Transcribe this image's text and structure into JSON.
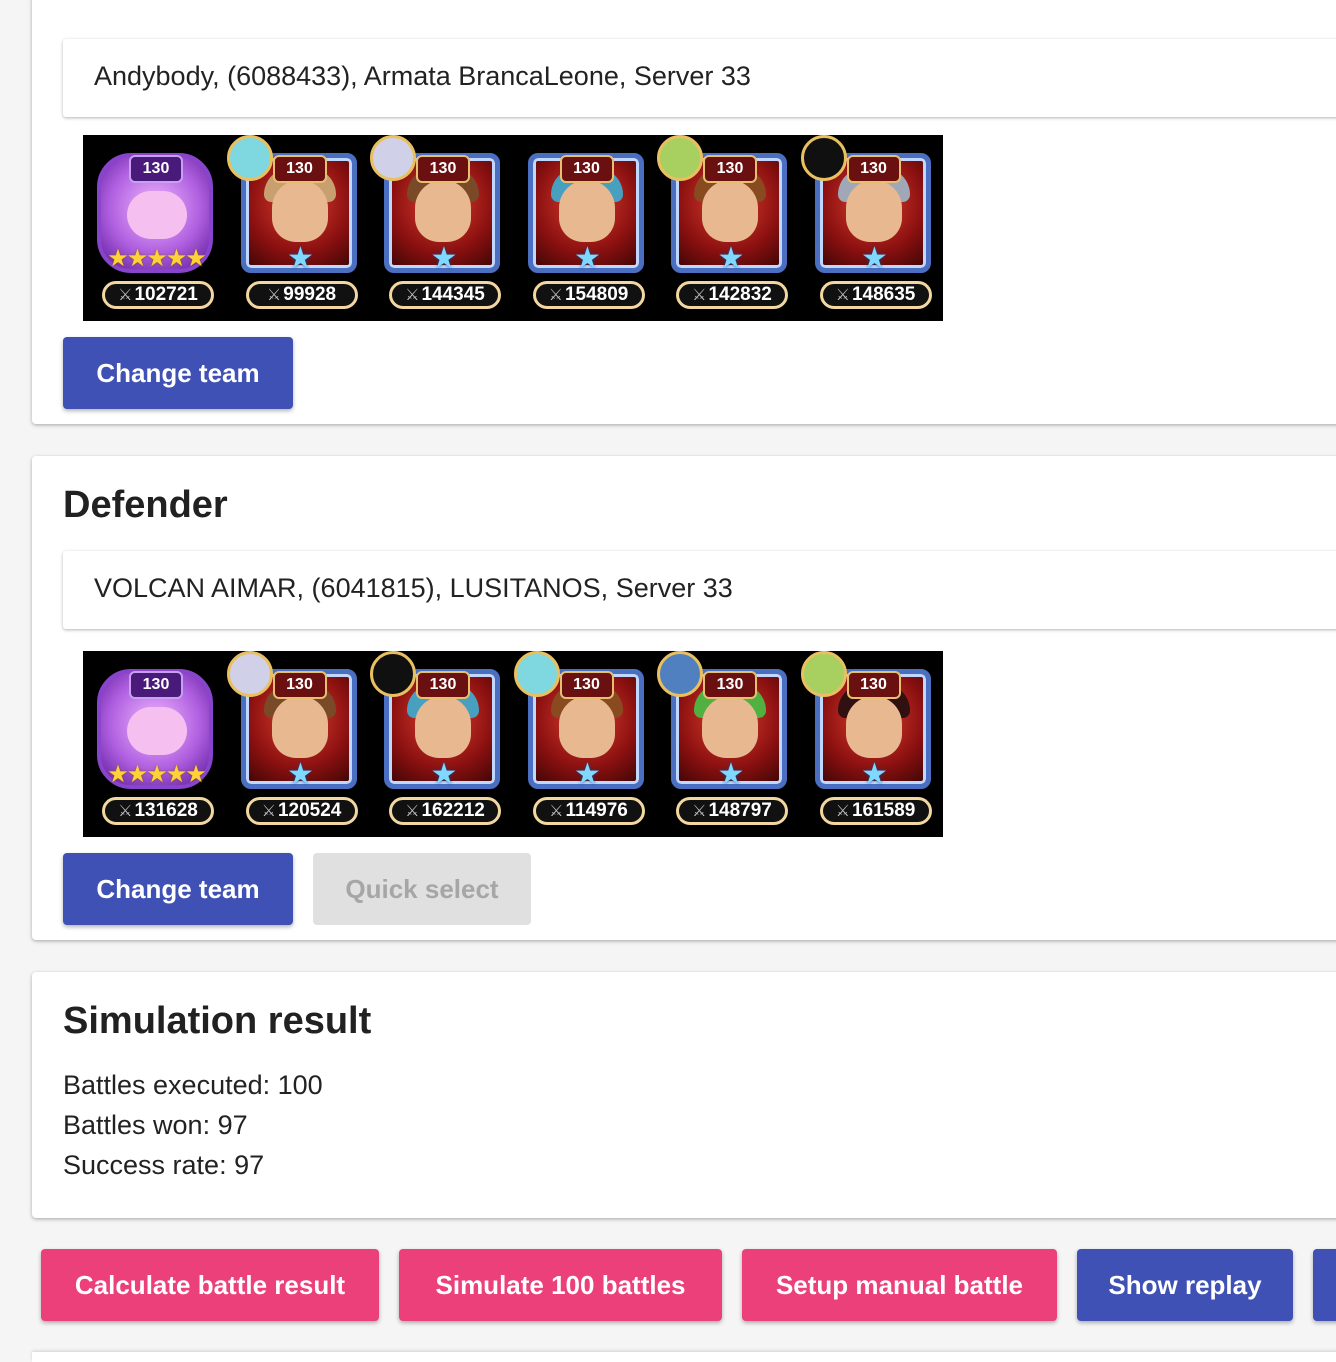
{
  "attacker": {
    "player": "Andybody, (6088433), Armata BrancaLeone, Server 33",
    "team": [
      {
        "type": "pet",
        "level": "130",
        "power": "102721",
        "stars": "★★★★★",
        "badge_color": "",
        "accent": "#c060e0"
      },
      {
        "type": "hero",
        "level": "130",
        "power": "99928",
        "stars": "★",
        "badge_color": "#7fd8e0",
        "accent": "#c8a070"
      },
      {
        "type": "hero",
        "level": "130",
        "power": "144345",
        "stars": "★",
        "badge_color": "#d0d0e8",
        "accent": "#7a4a28"
      },
      {
        "type": "hero",
        "level": "130",
        "power": "154809",
        "stars": "★",
        "badge_color": "",
        "accent": "#48a0c0"
      },
      {
        "type": "hero",
        "level": "130",
        "power": "142832",
        "stars": "★",
        "badge_color": "#a8d060",
        "accent": "#8a4a20"
      },
      {
        "type": "hero",
        "level": "130",
        "power": "148635",
        "stars": "★",
        "badge_color": "#101010",
        "accent": "#a0a8b8"
      }
    ],
    "change_team_label": "Change team"
  },
  "defender": {
    "title": "Defender",
    "player": "VOLCAN AIMAR, (6041815), LUSITANOS, Server 33",
    "team": [
      {
        "type": "pet",
        "level": "130",
        "power": "131628",
        "stars": "★★★★★",
        "badge_color": "",
        "accent": "#c060e0"
      },
      {
        "type": "hero",
        "level": "130",
        "power": "120524",
        "stars": "★",
        "badge_color": "#d0d0e8",
        "accent": "#7a4a28"
      },
      {
        "type": "hero",
        "level": "130",
        "power": "162212",
        "stars": "★",
        "badge_color": "#101010",
        "accent": "#48a0c0"
      },
      {
        "type": "hero",
        "level": "130",
        "power": "114976",
        "stars": "★",
        "badge_color": "#7fd8e0",
        "accent": "#8a4a20"
      },
      {
        "type": "hero",
        "level": "130",
        "power": "148797",
        "stars": "★",
        "badge_color": "#5080c0",
        "accent": "#50b040"
      },
      {
        "type": "hero",
        "level": "130",
        "power": "161589",
        "stars": "★",
        "badge_color": "#a8d060",
        "accent": "#301010"
      }
    ],
    "change_team_label": "Change team",
    "quick_select_label": "Quick select"
  },
  "result": {
    "title": "Simulation result",
    "battles_executed": "Battles executed: 100",
    "battles_won": "Battles won: 97",
    "success_rate": "Success rate: 97"
  },
  "actions": {
    "calculate": "Calculate battle result",
    "simulate": "Simulate 100 battles",
    "manual": "Setup manual battle",
    "replay": "Show replay"
  },
  "icons": {
    "power": "⚔"
  }
}
